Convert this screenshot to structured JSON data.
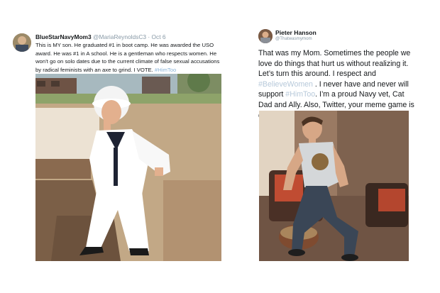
{
  "tweet1": {
    "display_name": "BlueStarNavyMom3",
    "handle": "@MariaReynoldsC3",
    "separator": "·",
    "date": "Oct 6",
    "text_main": "This is MY son. He graduated #1 in boot camp. He was awarded the USO award. He was #1 in A school. He is a gentleman who respects women. He won’t go on solo dates due to the current climate of false sexual accusations by radical feminists with an axe to grind. I VOTE.",
    "hashtag": "#HimToo"
  },
  "tweet2": {
    "display_name": "Pieter Hanson",
    "handle": "@Thatwasmymom",
    "text_part1": "That was my Mom. Sometimes the people we love do things that hurt us without realizing it. Let’s turn this around. I respect and",
    "hashtag1": "#BelieveWomen",
    "text_part2": ". I never have and never will support",
    "hashtag2": "#HimToo",
    "text_part3": ". I’m a proud Navy vet, Cat Dad and Ally. Also, Twitter, your meme game is on point."
  },
  "colors": {
    "text": "#14171a",
    "handle": "#8899a6",
    "hashtag": "#8ab4d8",
    "faded_hashtag": "#b7c9da"
  }
}
